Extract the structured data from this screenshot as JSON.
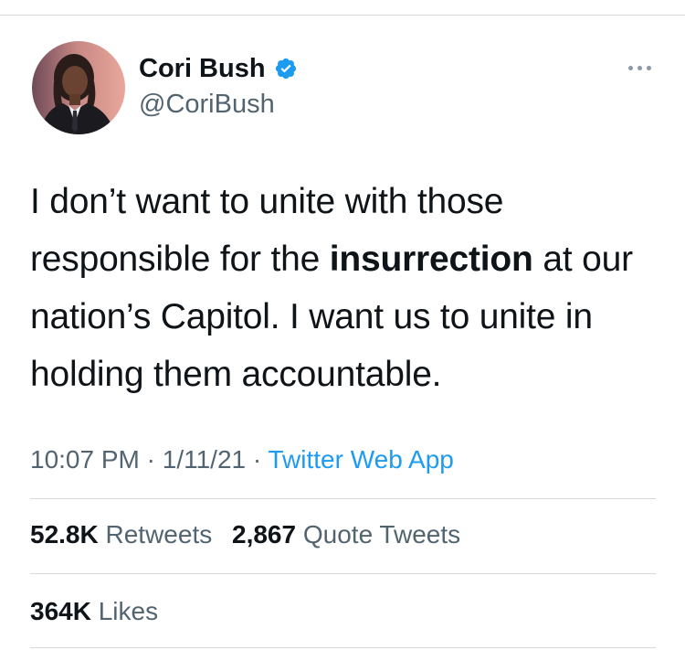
{
  "tweet": {
    "author": {
      "display_name": "Cori Bush",
      "handle": "@CoriBush",
      "verified": true,
      "avatar": "profile-photo"
    },
    "text": {
      "before_bold": "I don’t want to unite with those responsible for the ",
      "bold": "insurrection",
      "after_bold": " at our nation’s Capitol. I want us to unite in holding them accountable."
    },
    "time": "10:07 PM",
    "separator_1": "·",
    "date": "1/11/21",
    "separator_2": "·",
    "source": "Twitter Web App",
    "stats": {
      "retweets_count": "52.8K",
      "retweets_label": "Retweets",
      "quotes_count": "2,867",
      "quotes_label": "Quote Tweets",
      "likes_count": "364K",
      "likes_label": "Likes"
    }
  },
  "colors": {
    "text_primary": "#0f1419",
    "text_secondary": "#536471",
    "accent": "#1d9bf0",
    "divider": "#d6d9db"
  },
  "icons": {
    "verified": "verified-badge-icon",
    "more": "more-options-icon"
  }
}
